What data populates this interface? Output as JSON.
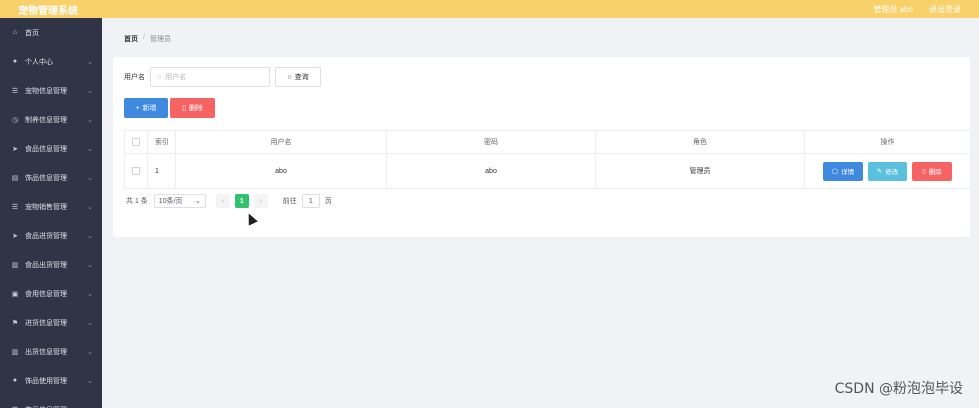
{
  "header": {
    "app_title": "宠物管理系统",
    "admin_label": "管理员 abo",
    "logout_label": "退出登录"
  },
  "sidebar": {
    "items": [
      {
        "label": "首页",
        "icon": "home-icon",
        "glyph": "⌂",
        "has_children": false
      },
      {
        "label": "个人中心",
        "icon": "user-icon",
        "glyph": "●",
        "has_children": true
      },
      {
        "label": "宠物信息管理",
        "icon": "list-icon",
        "glyph": "☰",
        "has_children": true
      },
      {
        "label": "制养信息管理",
        "icon": "clock-icon",
        "glyph": "◷",
        "has_children": true
      },
      {
        "label": "食品信息管理",
        "icon": "send-icon",
        "glyph": "➤",
        "has_children": true
      },
      {
        "label": "饰品信息管理",
        "icon": "folder-icon",
        "glyph": "▤",
        "has_children": true
      },
      {
        "label": "宠物销售管理",
        "icon": "list-icon",
        "glyph": "☰",
        "has_children": true
      },
      {
        "label": "食品进货管理",
        "icon": "send-icon",
        "glyph": "➤",
        "has_children": true
      },
      {
        "label": "食品出货管理",
        "icon": "chart-icon",
        "glyph": "▥",
        "has_children": true
      },
      {
        "label": "食用信息管理",
        "icon": "image-icon",
        "glyph": "▣",
        "has_children": true
      },
      {
        "label": "进货信息管理",
        "icon": "flag-icon",
        "glyph": "⚑",
        "has_children": true
      },
      {
        "label": "出货信息管理",
        "icon": "chart-icon",
        "glyph": "▥",
        "has_children": true
      },
      {
        "label": "饰品使用管理",
        "icon": "user-icon",
        "glyph": "●",
        "has_children": true
      },
      {
        "label": "饰品信息管理",
        "icon": "list-icon",
        "glyph": "☰",
        "has_children": true
      }
    ]
  },
  "breadcrumb": {
    "home": "首页",
    "separator": "/",
    "current": "管理员"
  },
  "search": {
    "label": "用户名",
    "placeholder": "用户名",
    "query_label": "查询"
  },
  "actions": {
    "add_label": "新增",
    "delete_label": "删除"
  },
  "table": {
    "columns": [
      "索引",
      "用户名",
      "密码",
      "角色",
      "操作"
    ],
    "rows": [
      {
        "index": "1",
        "username": "abo",
        "password": "abo",
        "role": "管理员"
      }
    ],
    "row_actions": {
      "detail": "详情",
      "edit": "修改",
      "delete": "删除"
    }
  },
  "pagination": {
    "total": "共 1 条",
    "page_size": "10条/页",
    "current_page": "1",
    "goto_label": "前往",
    "goto_value": "1",
    "page_suffix": "页"
  },
  "watermark": "CSDN @粉泡泡毕设",
  "colors": {
    "topbar": "#f9d16a",
    "sidebar": "#2f3447",
    "primary": "#3f8ae0",
    "danger": "#f56363",
    "info": "#5bc0de",
    "success": "#2ec26e"
  }
}
